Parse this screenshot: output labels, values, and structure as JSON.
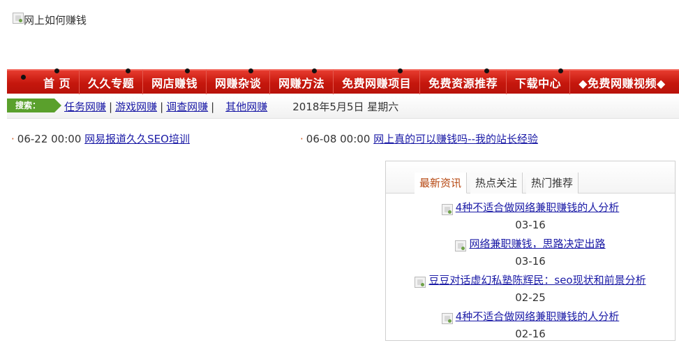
{
  "logo": {
    "alt_text": "网上如何赚钱",
    "icon": "broken-image-icon"
  },
  "nav": {
    "items": [
      "首 页",
      "久久专题",
      "网店赚钱",
      "网赚杂谈",
      "网赚方法",
      "免费网赚项目",
      "免费资源推荐",
      "下载中心",
      "◆免费网赚视频◆"
    ]
  },
  "subbar": {
    "search_label": "搜索：",
    "links": [
      "任务网赚",
      "游戏网赚",
      "调查网赚",
      "其他网赚"
    ],
    "date": "2018年5月5日 星期六"
  },
  "news": [
    {
      "bullet": "·",
      "time": "06-22 00:00",
      "title": "网易报道久久SEO培训"
    },
    {
      "bullet": "·",
      "time": "06-08 00:00",
      "title": "网上真的可以赚钱吗--我的站长经验"
    }
  ],
  "panel": {
    "tabs": [
      "最新资讯",
      "热点关注",
      "热门推荐"
    ],
    "active_tab": "最新资讯",
    "articles": [
      {
        "title": "4种不适合做网络兼职赚钱的人分析",
        "date": "03-16"
      },
      {
        "title": "网络兼职赚钱，思路决定出路",
        "date": "03-16"
      },
      {
        "title": "豆豆对话虚幻私塾陈辉民：seo现状和前景分析",
        "date": "02-25"
      },
      {
        "title": "4种不适合做网络兼职赚钱的人分析",
        "date": "02-16"
      }
    ]
  },
  "colors": {
    "nav_red": "#c5170d",
    "link_blue": "#1a1aa6",
    "search_green": "#5aa02c",
    "active_tab_text": "#b5460f"
  }
}
